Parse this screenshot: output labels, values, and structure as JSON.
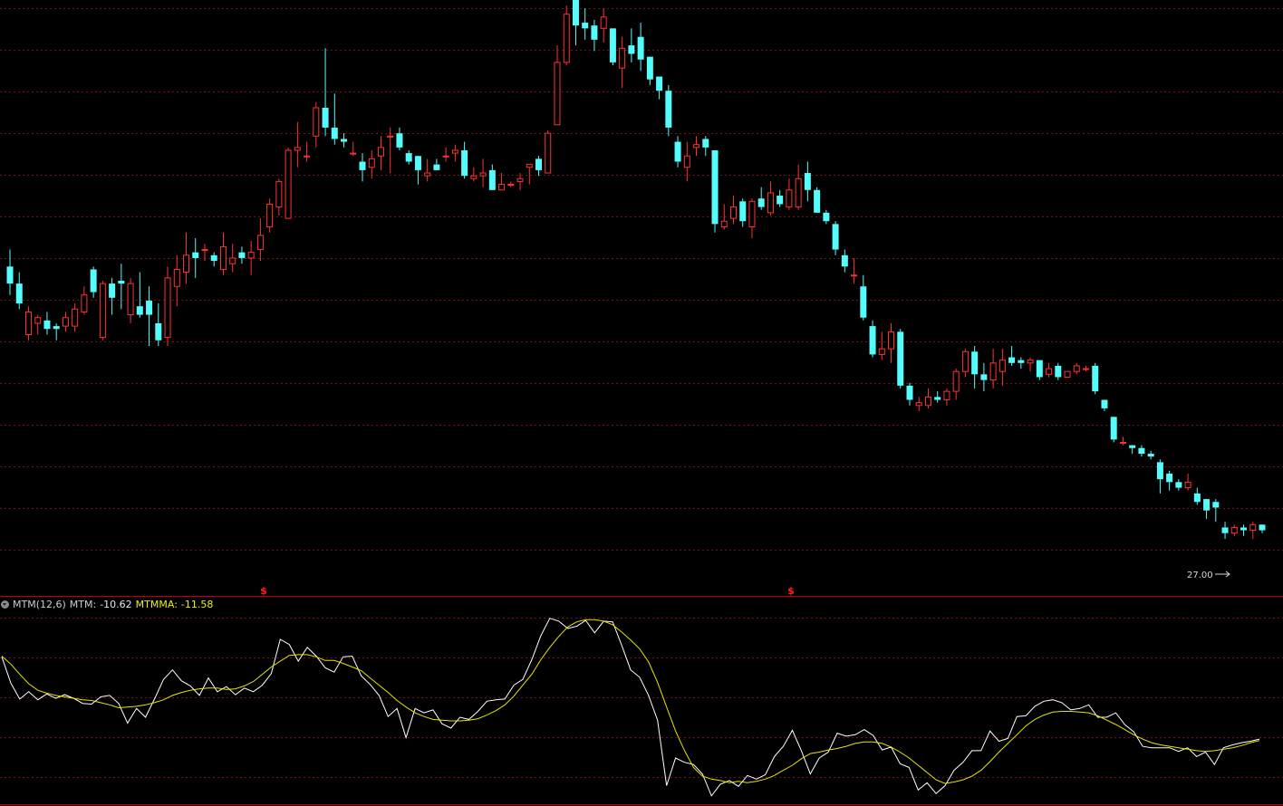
{
  "indicator": {
    "name": "MTM(12,6)",
    "mtm_label": "MTM:",
    "mtm_value": "-10.62",
    "mtmma_label": "MTMMA:",
    "mtmma_value": "-11.58"
  },
  "markers": {
    "dollar_symbol": "$",
    "last_price_label": "27.00"
  },
  "colors": {
    "background": "#000000",
    "up_candle": "#ff3232",
    "down_candle": "#54fcfc",
    "grid": "#7a1010",
    "separator": "#c00000",
    "mtm_line": "#ffffff",
    "mtmma_line": "#e6e600",
    "dollar_marker": "#ff2020"
  },
  "chart_data": [
    {
      "type": "candlestick",
      "title": "",
      "grid": true,
      "candles": [
        [
          38.9,
          38.3,
          39.5,
          37.9
        ],
        [
          38.3,
          37.6,
          38.7,
          37.4
        ],
        [
          36.5,
          37.3,
          37.5,
          36.3
        ],
        [
          36.9,
          37.1,
          37.2,
          36.5
        ],
        [
          37.0,
          36.7,
          37.3,
          36.5
        ],
        [
          36.8,
          36.7,
          36.9,
          36.3
        ],
        [
          36.8,
          37.1,
          37.3,
          36.6
        ],
        [
          36.8,
          37.4,
          37.6,
          36.6
        ],
        [
          37.3,
          37.9,
          38.2,
          37.2
        ],
        [
          38.8,
          38.0,
          38.9,
          37.8
        ],
        [
          36.4,
          38.3,
          38.4,
          36.3
        ],
        [
          38.3,
          37.8,
          38.5,
          37.2
        ],
        [
          38.4,
          38.3,
          39.0,
          37.4
        ],
        [
          37.2,
          38.3,
          38.5,
          36.9
        ],
        [
          37.5,
          37.2,
          38.7,
          37.1
        ],
        [
          37.7,
          37.2,
          38.2,
          36.1
        ],
        [
          36.9,
          36.3,
          37.6,
          36.1
        ],
        [
          36.4,
          38.5,
          38.9,
          36.1
        ],
        [
          38.2,
          38.8,
          39.3,
          37.5
        ],
        [
          38.7,
          39.3,
          40.1,
          38.3
        ],
        [
          39.4,
          39.2,
          39.9,
          38.5
        ],
        [
          39.5,
          39.5,
          39.7,
          39.1
        ],
        [
          39.3,
          39.1,
          39.4,
          38.9
        ],
        [
          38.8,
          39.6,
          40.1,
          38.6
        ],
        [
          39.0,
          39.2,
          39.7,
          38.7
        ],
        [
          39.4,
          39.2,
          39.6,
          39.0
        ],
        [
          39.2,
          39.4,
          39.8,
          38.6
        ],
        [
          39.5,
          40.0,
          40.6,
          39.1
        ],
        [
          40.3,
          41.1,
          41.3,
          40.1
        ],
        [
          41.0,
          41.9,
          42.0,
          40.7
        ],
        [
          40.6,
          43.0,
          43.1,
          40.6
        ],
        [
          43.0,
          43.1,
          44.0,
          42.4
        ],
        [
          42.8,
          42.8,
          43.3,
          42.6
        ],
        [
          43.5,
          44.5,
          44.7,
          43.1
        ],
        [
          44.5,
          43.8,
          46.6,
          43.5
        ],
        [
          43.8,
          43.4,
          45.0,
          43.2
        ],
        [
          43.4,
          43.3,
          43.6,
          43.1
        ],
        [
          42.9,
          42.9,
          43.3,
          42.8
        ],
        [
          42.6,
          42.3,
          42.9,
          41.9
        ],
        [
          42.4,
          42.7,
          43.0,
          42.0
        ],
        [
          42.8,
          43.1,
          43.5,
          42.3
        ],
        [
          43.5,
          43.5,
          43.8,
          42.2
        ],
        [
          43.6,
          43.1,
          43.8,
          43.0
        ],
        [
          42.9,
          42.6,
          43.0,
          42.5
        ],
        [
          42.8,
          42.3,
          42.8,
          41.8
        ],
        [
          42.1,
          42.2,
          42.7,
          41.9
        ],
        [
          42.5,
          42.3,
          42.7,
          42.3
        ],
        [
          42.8,
          42.8,
          43.1,
          42.6
        ],
        [
          42.9,
          43.0,
          43.2,
          42.6
        ],
        [
          43.0,
          42.1,
          43.3,
          42.0
        ],
        [
          42.0,
          42.1,
          42.4,
          41.9
        ],
        [
          42.1,
          42.2,
          42.7,
          41.7
        ],
        [
          42.3,
          41.6,
          42.5,
          41.6
        ],
        [
          41.6,
          41.8,
          42.2,
          41.6
        ],
        [
          41.8,
          41.8,
          41.9,
          41.7
        ],
        [
          41.9,
          42.0,
          42.2,
          41.6
        ],
        [
          42.4,
          42.5,
          42.5,
          41.8
        ],
        [
          42.7,
          42.3,
          42.8,
          42.1
        ],
        [
          42.2,
          43.6,
          43.7,
          42.2
        ],
        [
          43.9,
          46.1,
          46.7,
          43.9
        ],
        [
          46.1,
          47.8,
          48.1,
          46.0
        ],
        [
          48.3,
          47.4,
          48.5,
          46.7
        ],
        [
          47.5,
          47.3,
          48.0,
          46.9
        ],
        [
          47.4,
          46.9,
          47.6,
          46.5
        ],
        [
          47.3,
          47.7,
          48.0,
          46.8
        ],
        [
          47.3,
          46.1,
          47.2,
          46.0
        ],
        [
          45.9,
          46.6,
          47.0,
          45.2
        ],
        [
          46.7,
          46.4,
          47.3,
          46.1
        ],
        [
          47.0,
          46.2,
          47.5,
          45.8
        ],
        [
          46.3,
          45.5,
          46.3,
          45.3
        ],
        [
          45.6,
          45.1,
          45.6,
          44.8
        ],
        [
          45.1,
          43.8,
          45.3,
          43.5
        ],
        [
          43.3,
          42.6,
          43.5,
          42.4
        ],
        [
          42.4,
          42.8,
          43.3,
          41.9
        ],
        [
          43.1,
          43.2,
          43.5,
          42.8
        ],
        [
          43.4,
          43.1,
          43.5,
          42.8
        ],
        [
          43.0,
          40.4,
          43.0,
          40.1
        ],
        [
          40.3,
          40.5,
          41.1,
          40.2
        ],
        [
          40.6,
          41.0,
          41.4,
          40.4
        ],
        [
          41.2,
          40.5,
          41.3,
          40.3
        ],
        [
          40.3,
          41.2,
          41.3,
          39.9
        ],
        [
          41.3,
          41.0,
          41.7,
          40.9
        ],
        [
          40.8,
          41.5,
          41.9,
          40.7
        ],
        [
          41.4,
          41.1,
          41.6,
          41.0
        ],
        [
          41.0,
          41.6,
          42.0,
          40.9
        ],
        [
          41.0,
          42.0,
          42.5,
          40.9
        ],
        [
          42.2,
          41.6,
          42.6,
          41.2
        ],
        [
          41.6,
          40.8,
          41.7,
          40.8
        ],
        [
          40.8,
          40.5,
          40.9,
          40.4
        ],
        [
          40.4,
          39.5,
          40.5,
          39.3
        ],
        [
          39.3,
          38.9,
          39.5,
          38.7
        ],
        [
          38.6,
          38.6,
          39.2,
          38.3
        ],
        [
          38.2,
          37.1,
          38.6,
          37.0
        ],
        [
          36.8,
          35.8,
          37.0,
          35.7
        ],
        [
          35.8,
          36.0,
          36.6,
          35.6
        ],
        [
          36.0,
          36.6,
          36.9,
          35.5
        ],
        [
          36.6,
          34.7,
          36.7,
          34.6
        ],
        [
          34.7,
          34.2,
          34.8,
          34.0
        ],
        [
          34.0,
          34.1,
          34.3,
          33.8
        ],
        [
          34.0,
          34.3,
          34.6,
          33.9
        ],
        [
          34.3,
          34.2,
          34.5,
          34.1
        ],
        [
          34.2,
          34.5,
          34.6,
          34.0
        ],
        [
          34.5,
          35.2,
          35.3,
          34.2
        ],
        [
          35.2,
          35.9,
          36.0,
          35.0
        ],
        [
          35.9,
          35.1,
          36.1,
          34.6
        ],
        [
          35.1,
          34.9,
          35.5,
          34.5
        ],
        [
          34.9,
          35.5,
          36.0,
          34.6
        ],
        [
          35.2,
          35.6,
          36.0,
          34.7
        ],
        [
          35.7,
          35.5,
          36.1,
          35.4
        ],
        [
          35.6,
          35.5,
          35.7,
          35.3
        ],
        [
          35.5,
          35.6,
          35.7,
          35.2
        ],
        [
          35.6,
          35.0,
          35.6,
          34.9
        ],
        [
          35.1,
          35.3,
          35.5,
          35.0
        ],
        [
          35.4,
          35.0,
          35.5,
          34.9
        ],
        [
          35.0,
          35.2,
          35.2,
          35.0
        ],
        [
          35.2,
          35.4,
          35.5,
          35.1
        ],
        [
          35.3,
          35.3,
          35.4,
          35.2
        ],
        [
          35.4,
          34.5,
          35.5,
          34.4
        ],
        [
          34.2,
          33.9,
          34.2,
          33.8
        ],
        [
          33.6,
          32.8,
          33.6,
          32.7
        ],
        [
          32.7,
          32.7,
          32.9,
          32.6
        ],
        [
          32.6,
          32.5,
          32.6,
          32.3
        ],
        [
          32.5,
          32.3,
          32.6,
          32.2
        ],
        [
          32.3,
          32.2,
          32.4,
          32.1
        ],
        [
          32.0,
          31.4,
          32.1,
          30.9
        ],
        [
          31.6,
          31.3,
          31.7,
          31.0
        ],
        [
          31.3,
          31.1,
          31.4,
          31.0
        ],
        [
          31.1,
          31.3,
          31.6,
          31.0
        ],
        [
          30.9,
          30.6,
          31.1,
          30.5
        ],
        [
          30.7,
          30.3,
          30.7,
          30.0
        ],
        [
          30.6,
          30.4,
          30.7,
          29.9
        ],
        [
          29.7,
          29.5,
          29.9,
          29.3
        ],
        [
          29.5,
          29.7,
          29.8,
          29.4
        ],
        [
          29.7,
          29.6,
          29.8,
          29.4
        ],
        [
          29.6,
          29.8,
          29.9,
          29.3
        ],
        [
          29.8,
          29.6,
          29.8,
          29.5
        ]
      ],
      "ylim": [
        28.5,
        48.3
      ],
      "last_price": 27.0
    },
    {
      "type": "line",
      "title": "MTM(12,6)",
      "grid": true,
      "ylim": [
        -16,
        12
      ],
      "series": [
        {
          "name": "MTM",
          "values": [
            4.5,
            0.9,
            -1.3,
            -0.3,
            -1.4,
            -0.6,
            -1.2,
            -0.7,
            -1.2,
            -1.9,
            -2.0,
            -1.0,
            -0.8,
            -1.9,
            -4.6,
            -2.6,
            -3.8,
            -1.3,
            1.4,
            2.7,
            1.2,
            0.5,
            -0.8,
            1.6,
            -0.3,
            0.4,
            -0.7,
            0.2,
            -0.3,
            0.6,
            2.2,
            6.9,
            6.2,
            3.9,
            5.8,
            4.6,
            3.0,
            2.4,
            4.5,
            4.6,
            1.9,
            0.7,
            -0.8,
            -3.7,
            -2.6,
            -6.6,
            -2.6,
            -3.2,
            -2.8,
            -4.7,
            -5.3,
            -3.8,
            -4.1,
            -3.0,
            -1.6,
            -1.4,
            -1.3,
            0.6,
            1.4,
            4.1,
            7.4,
            9.8,
            9.4,
            8.4,
            8.7,
            9.5,
            7.8,
            9.4,
            9.3,
            6.1,
            2.7,
            1.7,
            -0.8,
            -4.2,
            -13.2,
            -9.4,
            -10.0,
            -10.3,
            -11.6,
            -14.6,
            -13.0,
            -12.5,
            -13.3,
            -11.8,
            -12.3,
            -11.7,
            -9.2,
            -7.8,
            -5.6,
            -8.4,
            -11.6,
            -9.4,
            -8.6,
            -6.0,
            -6.4,
            -6.2,
            -5.5,
            -6.3,
            -8.3,
            -7.9,
            -10.2,
            -10.7,
            -13.8,
            -12.8,
            -14.3,
            -13.2,
            -11.1,
            -10.0,
            -8.4,
            -8.4,
            -5.7,
            -7.1,
            -6.7,
            -3.7,
            -3.6,
            -2.3,
            -1.6,
            -1.4,
            -1.8,
            -2.8,
            -2.6,
            -2.1,
            -3.8,
            -3.8,
            -3.2,
            -4.8,
            -5.8,
            -7.8,
            -8.0,
            -8.0,
            -8.0,
            -8.5,
            -8.0,
            -9.2,
            -8.6,
            -10.3,
            -8.0,
            -7.6,
            -7.3,
            -7.1,
            -6.8
          ]
        },
        {
          "name": "MTMMA",
          "values": [
            4.6,
            3.5,
            2.1,
            0.8,
            -0.1,
            -0.5,
            -0.8,
            -1.0,
            -1.2,
            -1.4,
            -1.5,
            -1.8,
            -2.1,
            -2.5,
            -2.4,
            -2.3,
            -2.1,
            -1.8,
            -1.4,
            -0.8,
            -0.4,
            -0.1,
            0.1,
            0.2,
            0.2,
            0.0,
            0.1,
            0.5,
            1.1,
            2.1,
            3.1,
            3.9,
            4.7,
            4.8,
            4.8,
            4.5,
            4.0,
            4.0,
            3.6,
            3.1,
            2.6,
            1.6,
            0.6,
            -0.4,
            -1.5,
            -2.4,
            -3.2,
            -3.7,
            -4.1,
            -4.2,
            -4.3,
            -4.3,
            -4.2,
            -4.0,
            -3.5,
            -2.9,
            -2.1,
            -0.9,
            0.6,
            2.1,
            4.1,
            5.8,
            7.3,
            8.6,
            9.3,
            9.6,
            9.6,
            9.4,
            8.9,
            7.9,
            6.8,
            5.6,
            3.8,
            1.0,
            -2.4,
            -5.7,
            -8.4,
            -10.7,
            -11.9,
            -12.3,
            -12.5,
            -12.8,
            -12.6,
            -12.8,
            -12.6,
            -12.3,
            -11.8,
            -11.1,
            -10.4,
            -9.5,
            -8.8,
            -8.6,
            -8.3,
            -8.1,
            -7.8,
            -7.4,
            -7.2,
            -7.2,
            -7.4,
            -7.9,
            -8.6,
            -9.4,
            -10.4,
            -11.4,
            -12.4,
            -12.9,
            -12.7,
            -12.4,
            -11.9,
            -11.1,
            -9.9,
            -8.6,
            -7.4,
            -6.2,
            -5.0,
            -4.1,
            -3.5,
            -3.1,
            -3.0,
            -3.0,
            -3.1,
            -3.2,
            -3.6,
            -4.2,
            -4.8,
            -5.5,
            -6.2,
            -6.8,
            -7.3,
            -7.6,
            -7.8,
            -8.0,
            -8.2,
            -8.4,
            -8.5,
            -8.4,
            -8.2,
            -8.0,
            -7.7,
            -7.3,
            -7.0
          ]
        }
      ]
    }
  ]
}
